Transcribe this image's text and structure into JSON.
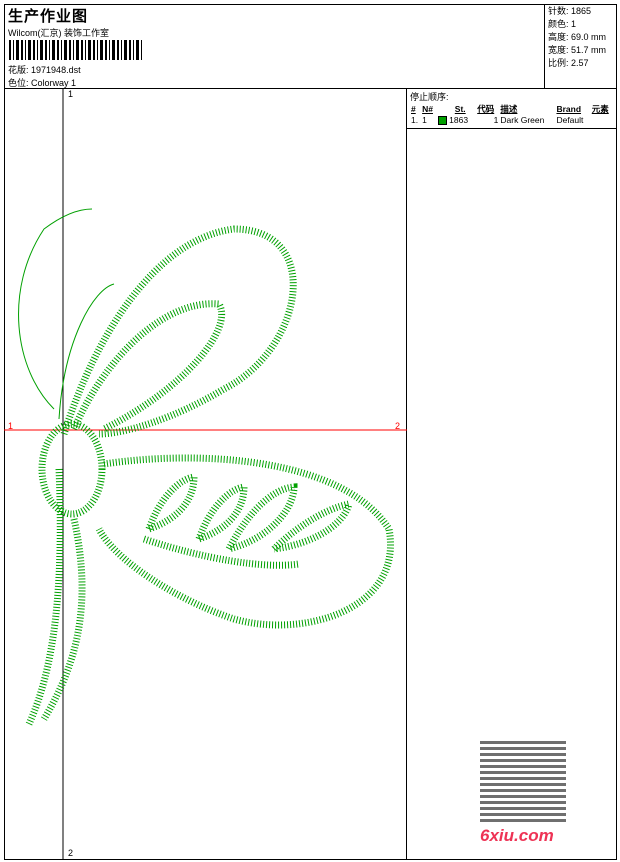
{
  "header": {
    "title": "生产作业图",
    "studio": "Wilcom(汇京) 装饰工作室",
    "design_label": "花版:",
    "design_value": "1971948.dst",
    "colorway_label": "色位:",
    "colorway_value": "Colorway 1"
  },
  "info": {
    "stitches": "针数: 1865",
    "colors": "颜色: 1",
    "height": "高度: 69.0 mm",
    "width": "宽度: 51.7 mm",
    "scale": "比例: 2.57"
  },
  "stop_sequence": {
    "title": "停止顺序:",
    "columns": [
      "#",
      "N#",
      "St.",
      "代码",
      "描述",
      "Brand",
      "元素"
    ],
    "rows": [
      {
        "num": "1.",
        "n": "1",
        "color": "#00a000",
        "st": "1863",
        "code": "1",
        "desc": "Dark Green",
        "brand": "Default",
        "element": ""
      }
    ]
  },
  "axes": {
    "v_top": "1",
    "v_bottom": "2",
    "h_left": "1",
    "h_right": "2"
  },
  "watermark": {
    "site": "6xiu.com"
  },
  "colors": {
    "thread": "#00a000",
    "axis_h": "#ff0000"
  }
}
